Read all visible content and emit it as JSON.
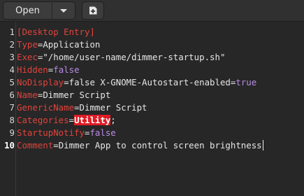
{
  "toolbar": {
    "open_label": "Open",
    "menu_icon": "chevron-down-icon",
    "new_tab_icon": "new-document-icon"
  },
  "editor": {
    "line_numbers": [
      "1",
      "2",
      "3",
      "4",
      "5",
      "6",
      "7",
      "8",
      "9",
      "10"
    ],
    "lines": [
      {
        "k": "[Desktop Entry]",
        "eq": "",
        "v": "",
        "extra": ""
      },
      {
        "k": "Type",
        "eq": "=",
        "v": "Application",
        "extra": ""
      },
      {
        "k": "Exec",
        "eq": "=",
        "v": "\"/home/user-name/dimmer-startup.sh\"",
        "extra": ""
      },
      {
        "k": "Hidden",
        "eq": "=",
        "v": "false",
        "extra": ""
      },
      {
        "k": "NoDisplay",
        "eq": "=",
        "v": "false X-GNOME-Autostart-enabled=",
        "extra": "true"
      },
      {
        "k": "Name",
        "eq": "=",
        "v": "Dimmer Script",
        "extra": ""
      },
      {
        "k": "GenericName",
        "eq": "=",
        "v": "Dimmer Script",
        "extra": ""
      },
      {
        "k": "Categories",
        "eq": "=",
        "v": "Utility",
        "extra": ";"
      },
      {
        "k": "StartupNotify",
        "eq": "=",
        "v": "false",
        "extra": ""
      },
      {
        "k": "Comment",
        "eq": "=",
        "v": "Dimmer App to control screen brightness",
        "extra": ""
      }
    ],
    "current_line": "10"
  },
  "colors": {
    "key": "#e0433b",
    "highlight": "#e01b24",
    "background": "#272727"
  }
}
